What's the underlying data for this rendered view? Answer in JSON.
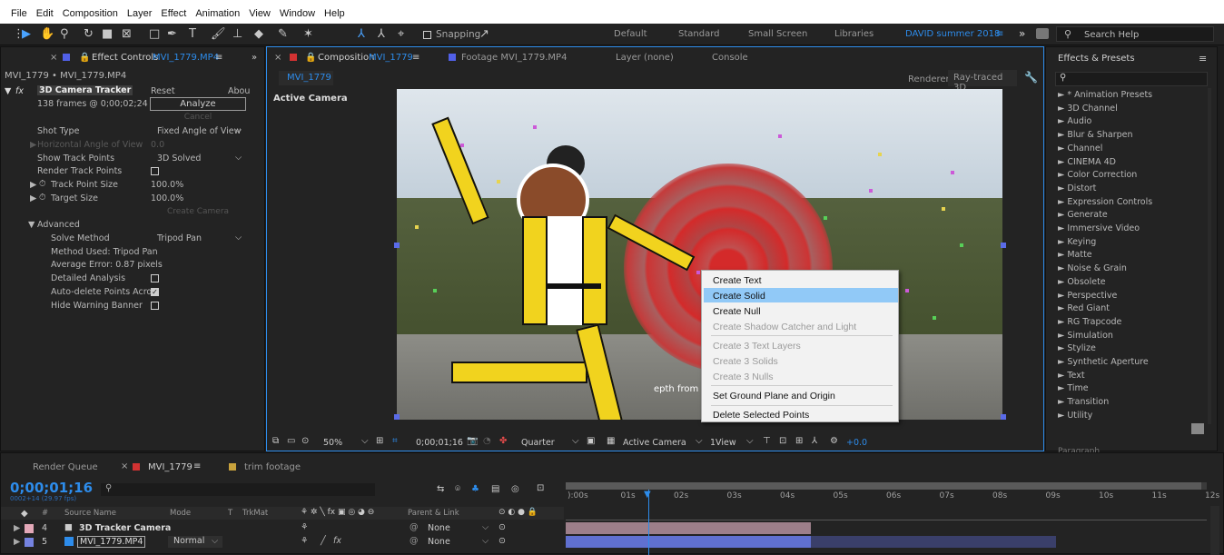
{
  "menubar": {
    "items": [
      "File",
      "Edit",
      "Composition",
      "Layer",
      "Effect",
      "Animation",
      "View",
      "Window",
      "Help"
    ]
  },
  "toolbar": {
    "snapping_label": "Snapping",
    "workspaces": [
      "Default",
      "Standard",
      "Small Screen",
      "Libraries"
    ],
    "active_workspace": "DAVID summer 2018",
    "overflow": "»",
    "search_placeholder": "Search Help"
  },
  "effect_controls": {
    "tab_label": "Effect Controls",
    "tab_target": "MVI_1779.MP4",
    "breadcrumb": "MVI_1779 • MVI_1779.MP4",
    "fx_badge": "fx",
    "effect_name": "3D Camera Tracker",
    "reset": "Reset",
    "about": "Abou",
    "frames_info": "138 frames @ 0;00;02;24",
    "analyze": "Analyze",
    "cancel": "Cancel",
    "shot_type_label": "Shot Type",
    "shot_type_value": "Fixed Angle of View",
    "hangle_label": "Horizontal Angle of View",
    "hangle_value": "0.0",
    "show_track_label": "Show Track Points",
    "show_track_value": "3D Solved",
    "render_track_label": "Render Track Points",
    "track_size_label": "Track Point Size",
    "track_size_value": "100.0%",
    "target_size_label": "Target Size",
    "target_size_value": "100.0%",
    "create_camera": "Create Camera",
    "advanced_label": "Advanced",
    "solve_method_label": "Solve Method",
    "solve_method_value": "Tripod Pan",
    "method_used": "Method Used: Tripod Pan",
    "avg_error": "Average Error: 0.87 pixels",
    "detailed_label": "Detailed Analysis",
    "autodelete_label": "Auto-delete Points Acro",
    "hide_warning_label": "Hide Warning Banner"
  },
  "composition": {
    "tab_label": "Composition",
    "tab_target": "MVI_1779",
    "footage_tab": "Footage MVI_1779.MP4",
    "layer_tab": "Layer (none)",
    "console_tab": "Console",
    "comp_chip": "MVI_1779",
    "renderer_label": "Renderer:",
    "renderer_value": "Ray-traced 3D",
    "active_camera": "Active Camera",
    "overlay_text": "epth from a",
    "zoom": "50%",
    "timecode": "0;00;01;16",
    "resolution": "Quarter",
    "camera": "Active Camera",
    "view": "1View",
    "exposure": "+0.0"
  },
  "context_menu": {
    "items": [
      {
        "label": "Create Text",
        "enabled": true,
        "highlight": false
      },
      {
        "label": "Create Solid",
        "enabled": true,
        "highlight": true
      },
      {
        "label": "Create Null",
        "enabled": true,
        "highlight": false
      },
      {
        "label": "Create Shadow Catcher and Light",
        "enabled": false,
        "highlight": false
      },
      {
        "label": "Create 3 Text Layers",
        "enabled": false,
        "highlight": false
      },
      {
        "label": "Create 3 Solids",
        "enabled": false,
        "highlight": false
      },
      {
        "label": "Create 3 Nulls",
        "enabled": false,
        "highlight": false
      },
      {
        "label": "Set Ground Plane and Origin",
        "enabled": true,
        "highlight": false
      },
      {
        "label": "Delete Selected Points",
        "enabled": true,
        "highlight": false
      }
    ]
  },
  "effects_presets": {
    "title": "Effects & Presets",
    "items": [
      "* Animation Presets",
      "3D Channel",
      "Audio",
      "Blur & Sharpen",
      "Channel",
      "CINEMA 4D",
      "Color Correction",
      "Distort",
      "Expression Controls",
      "Generate",
      "Immersive Video",
      "Keying",
      "Matte",
      "Noise & Grain",
      "Obsolete",
      "Perspective",
      "Red Giant",
      "RG Trapcode",
      "Simulation",
      "Stylize",
      "Synthetic Aperture",
      "Text",
      "Time",
      "Transition",
      "Utility"
    ],
    "paragraph_label": "Paragraph"
  },
  "timeline": {
    "render_queue": "Render Queue",
    "tab_comp": "MVI_1779",
    "tab_trim": "trim footage",
    "timecode": "0;00;01;16",
    "frame_info": "0002+14 (29.97 fps)",
    "headers": {
      "num": "#",
      "source": "Source Name",
      "mode": "Mode",
      "t": "T",
      "trkmat": "TrkMat",
      "parent": "Parent & Link"
    },
    "ruler": [
      "):00s",
      "01s",
      "02s",
      "03s",
      "04s",
      "05s",
      "06s",
      "07s",
      "08s",
      "09s",
      "10s",
      "11s",
      "12s"
    ],
    "layers": [
      {
        "num": "4",
        "name": "3D Tracker Camera",
        "mode": "",
        "parent": "None",
        "color": "#e3a8b8"
      },
      {
        "num": "5",
        "name": "MVI_1779.MP4",
        "mode": "Normal",
        "parent": "None",
        "color": "#7583e0"
      }
    ]
  }
}
